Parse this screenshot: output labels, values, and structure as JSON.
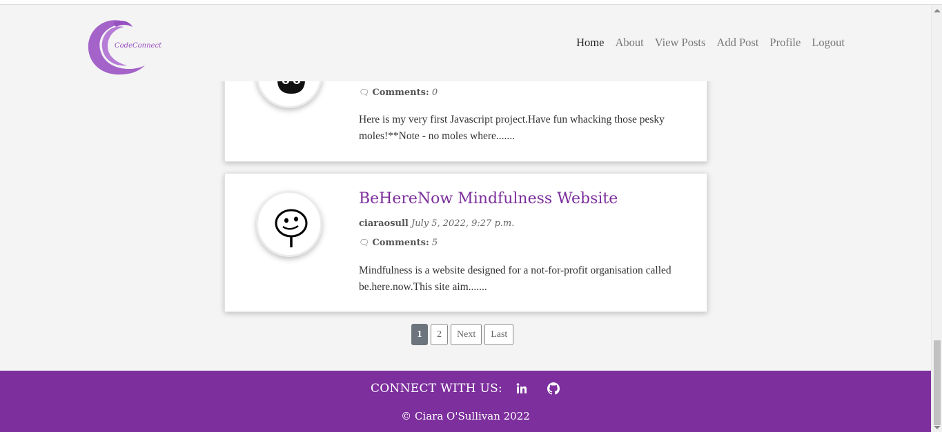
{
  "navbar": {
    "logo_text": "CodeConnect",
    "links": [
      {
        "label": "Home"
      },
      {
        "label": "About"
      },
      {
        "label": "View Posts"
      },
      {
        "label": "Add Post"
      },
      {
        "label": "Profile"
      },
      {
        "label": "Logout"
      }
    ]
  },
  "posts": [
    {
      "title": "",
      "author": "",
      "date": "",
      "comments_label": "Comments:",
      "comments_count": "0",
      "excerpt": "Here is my very first Javascript project.Have fun whacking those pesky moles!**Note - no moles where.......",
      "avatar_icon": "cat-icon"
    },
    {
      "title": "BeHereNow Mindfulness Website",
      "author": "ciaraosull",
      "date": "July 5, 2022, 9:27 p.m.",
      "comments_label": "Comments:",
      "comments_count": "5",
      "excerpt": "Mindfulness is a website designed for a not-for-profit organisation called be.here.now.This site aim.......",
      "avatar_icon": "smiley-face-icon"
    }
  ],
  "pagination": {
    "pages": [
      "1",
      "2"
    ],
    "next": "Next",
    "last": "Last",
    "current": "1"
  },
  "footer": {
    "connect_label": "CONNECT WITH US:",
    "copyright": "© Ciara O'Sullivan 2022"
  },
  "colors": {
    "brand": "#7d2f9d",
    "title": "#7b2e9b",
    "logo": "#9b4fc0"
  }
}
